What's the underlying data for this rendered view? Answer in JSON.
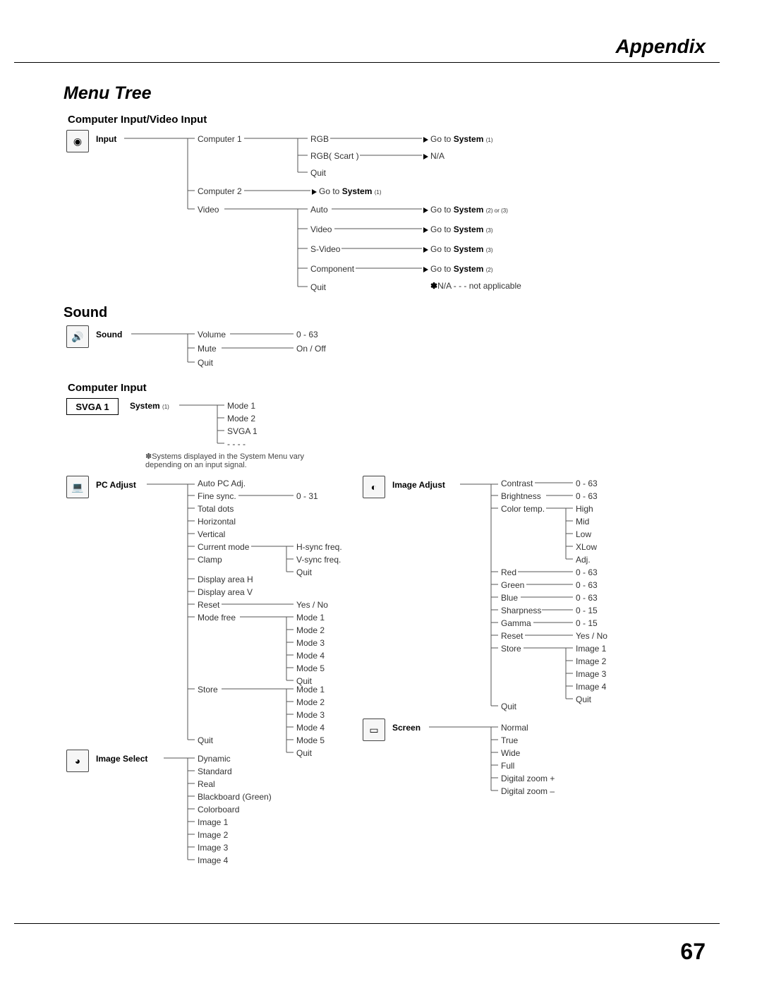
{
  "chapter": "Appendix",
  "title": "Menu Tree",
  "pageNum": "67",
  "sections": {
    "s1": {
      "heading": "Computer Input/Video Input"
    },
    "sound": {
      "heading": "Sound"
    },
    "compInput": {
      "heading": "Computer Input"
    }
  },
  "root": {
    "input": "Input",
    "sound": "Sound",
    "system": "System",
    "systemSub": "(1)",
    "pcAdjust": "PC Adjust",
    "imageSelect": "Image Select",
    "imageAdjust": "Image Adjust",
    "screen": "Screen"
  },
  "svga": "SVGA  1",
  "input": {
    "comp1": "Computer 1",
    "comp2": "Computer 2",
    "video": "Video",
    "rgb": "RGB",
    "rgbScart": "RGB( Scart )",
    "quit": "Quit",
    "auto": "Auto",
    "vvideo": "Video",
    "svideo": "S-Video",
    "component": "Component",
    "goSys1": "Go to",
    "goSys1b": "System",
    "goSys1s": "(1)",
    "na": "N/A",
    "goSys23": "Go to",
    "goSys23b": "System",
    "goSys23s": "(2) or (3)",
    "goSys3": "Go to",
    "goSys3b": "System",
    "goSys3s": "(3)",
    "goSys2": "Go to",
    "goSys2b": "System",
    "goSys2s": "(2)",
    "naNote": "N/A - - - not applicable",
    "star": "✽"
  },
  "sound": {
    "volume": "Volume",
    "mute": "Mute",
    "quit": "Quit",
    "r063": "0 - 63",
    "onoff": "On / Off"
  },
  "system": {
    "m1": "Mode 1",
    "m2": "Mode 2",
    "svga": "SVGA 1",
    "dots": "- - - -",
    "note": "✽Systems displayed in the System Menu vary depending on an input signal."
  },
  "pc": {
    "autopc": "Auto PC Adj.",
    "finesync": "Fine sync.",
    "totaldots": "Total dots",
    "horizontal": "Horizontal",
    "vertical": "Vertical",
    "current": "Current mode",
    "clamp": "Clamp",
    "dispH": "Display area H",
    "dispV": "Display area V",
    "reset": "Reset",
    "modefree": "Mode free",
    "store": "Store",
    "quit": "Quit",
    "r031": "0 - 31",
    "hsync": "H-sync freq.",
    "vsync": "V-sync freq.",
    "q2": "Quit",
    "yesno": "Yes / No",
    "m1": "Mode 1",
    "m2": "Mode 2",
    "m3": "Mode 3",
    "m4": "Mode 4",
    "m5": "Mode 5"
  },
  "imgSel": {
    "dynamic": "Dynamic",
    "standard": "Standard",
    "real": "Real",
    "blackboard": "Blackboard (Green)",
    "colorboard": "Colorboard",
    "i1": "Image 1",
    "i2": "Image 2",
    "i3": "Image 3",
    "i4": "Image 4"
  },
  "imgAdj": {
    "contrast": "Contrast",
    "brightness": "Brightness",
    "colortemp": "Color temp.",
    "high": "High",
    "mid": "Mid",
    "low": "Low",
    "xlow": "XLow",
    "adj": "Adj.",
    "red": "Red",
    "green": "Green",
    "blue": "Blue",
    "sharpness": "Sharpness",
    "gamma": "Gamma",
    "reset": "Reset",
    "store": "Store",
    "quit": "Quit",
    "r063": "0 - 63",
    "r015": "0 - 15",
    "yesno": "Yes / No",
    "i1": "Image 1",
    "i2": "Image 2",
    "i3": "Image 3",
    "i4": "Image 4",
    "q2": "Quit"
  },
  "screen": {
    "normal": "Normal",
    "true": "True",
    "wide": "Wide",
    "full": "Full",
    "dzplus": "Digital zoom +",
    "dzminus": "Digital zoom –"
  }
}
